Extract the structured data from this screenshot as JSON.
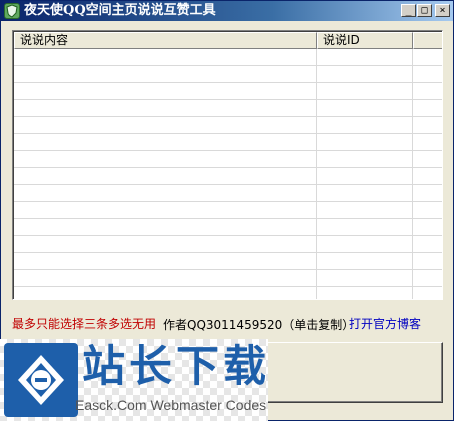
{
  "window": {
    "title": "夜天使QQ空间主页说说互赞工具",
    "minimize_glyph": "_",
    "maximize_glyph": "□",
    "close_glyph": "×"
  },
  "list": {
    "columns": [
      "说说内容",
      "说说ID",
      ""
    ],
    "rows": []
  },
  "footer": {
    "warning_text": "最多只能选择三条多选无用",
    "author_text": "作者QQ3011459520（单击复制）",
    "blog_link_text": "打开官方博客",
    "action_button_label": ""
  },
  "watermark": {
    "title": "站长下载",
    "subtitle": "Easck.Com Webmaster Codes"
  },
  "colors": {
    "warning": "#c00000",
    "link": "#0000c0",
    "watermark_blue": "#1e5faa"
  }
}
